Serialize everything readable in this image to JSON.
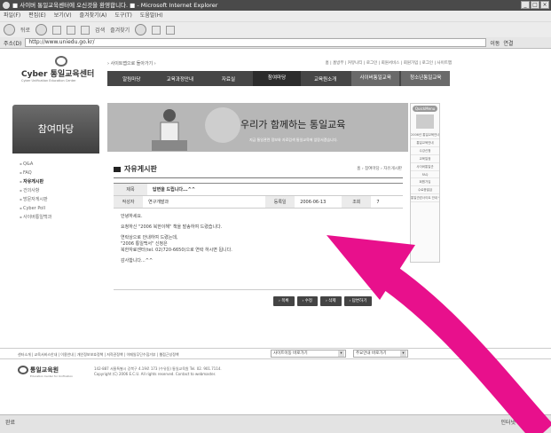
{
  "browser": {
    "title": "■ 사이버 통일교육센터에 오신것을 환영합니다. ■ - Microsoft Internet Explorer",
    "menu": [
      "파일(F)",
      "편집(E)",
      "보기(V)",
      "즐겨찾기(A)",
      "도구(T)",
      "도움말(H)"
    ],
    "toolbar": {
      "back": "뒤로",
      "search": "검색",
      "favorites": "즐겨찾기"
    },
    "address_label": "주소(D)",
    "address": "http://www.uniedu.go.kr/",
    "go_label": "이동",
    "links_label": "연결"
  },
  "site": {
    "logo_title": "Cyber 통일교육센터",
    "logo_sub": "Cyber Unification Education Center",
    "top_link": "› 사이트맵으로 돌아가기 ›",
    "util_links": "홈 | 홈방부 | 커뮤니티 | 로그인 | 회원서비스 | 회원가입 | 로그인 | 사이트맵",
    "gnb": [
      "알림마당",
      "교육과정안내",
      "자료실",
      "참여마당",
      "교육원소개",
      "사이버통일교육",
      "청소년통일교육"
    ]
  },
  "sidebar": {
    "title": "참여마당",
    "items": [
      "Q&A",
      "FAQ",
      "자유게시판",
      "건의사항",
      "방문자게시판",
      "Cyber Poll",
      "사이버통일백과"
    ]
  },
  "banner": {
    "calligraphy": "우리가 함께하는 통일교육",
    "subtitle": "지금 통일관련 정보와 자료검색 통일교육에 앞장서겠습니다."
  },
  "quick_menu": {
    "title": "QuickMenu",
    "items": [
      "2006년 통일교육안내",
      "통일교육안내",
      "수강신청",
      "교육일정",
      "사이버통일관",
      "FAQ",
      "회원가입",
      "수료증발급",
      "통일관련사이트 안내 링크"
    ]
  },
  "board": {
    "title": "자유게시판",
    "breadcrumb": "홈 › 참여마당 › 자유게시판",
    "subject_label": "제목",
    "subject": "답변을 드립니다...^^",
    "author_label": "작성자",
    "author": "연구개발과",
    "date_label": "등록일",
    "date": "2006-06-13",
    "hits_label": "조회",
    "hits": "7",
    "body": [
      "안녕하세요.",
      "요청하신 \"2006 북한이해\" 책을 발송하여 드렸습니다.",
      "연락상으로 안내하여 드렸는데,",
      "\"2006 통일백서\" 신청은",
      "북한자료센터(tel. 02)720-6650)으로 연락 하시면 됩니다.",
      "감사합니다...^^"
    ],
    "buttons": [
      "› 목록",
      "› 수정",
      "› 삭제",
      "› 답변하기"
    ]
  },
  "footer": {
    "links": "센터소개 | 교육서비스안내 | 이용안내 | 개인정보보호정책 | 저작권정책 | 이메일무단수집거부 | 웹접근성정책",
    "select1": "사이트이동 바로가기",
    "select2": "주요안내 바로가기",
    "logo_title": "통일교육원",
    "logo_sub": "Education Center for Unification",
    "address_line1": "142-887 서울특별시 강북구 4.19로 173 (수유동) 통일교육원  Tel. 02. 901.7114.",
    "address_line2": "Copyright (C) 2006 E.C.U. All rights reserved. Contact to webmaster."
  },
  "status": {
    "left": "완료",
    "right": "인터넷"
  },
  "colors": {
    "gnb_bg": "#464646",
    "arrow": "#e8108c"
  }
}
